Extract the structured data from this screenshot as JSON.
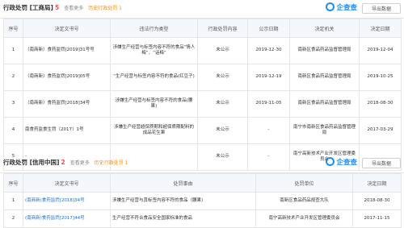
{
  "section1": {
    "title": "行政处罚 [工商局]",
    "count": "5",
    "more": "查看更多",
    "history": "历史行政处罚 1",
    "brand": "企查查",
    "export": "导出数据",
    "headers": [
      "序号",
      "决定文书号",
      "违法行为类型",
      "行政处罚内容",
      "公示日期",
      "决定机关",
      "决定日期"
    ],
    "rows": [
      [
        "1",
        "（南商新）食药监罚[2019]31号号",
        "涉嫌生产经营与标签内容不符的食品“情人梅”、“话梅”",
        "未公示",
        "2019-12-30",
        "南新区食品药品监督管理局",
        "2019-12-04"
      ],
      [
        "2",
        "（南商新）食药监罚[2019]05号",
        "“生产经营与标签内容不符的食品(红豆子)",
        "未公示",
        "2019-12-19",
        "南新区食品药品监督管理局",
        "2019-10-25"
      ],
      [
        "3",
        "（南商新）食药监罚[2018]34号",
        "涉嫌生产经营与标签内容不符的食品(腰果)",
        "未公示",
        "2019-11-05",
        "南新区食品药品监督管理局",
        "2018-08-30"
      ],
      [
        "4",
        "南食药监食生罚〔2017〕1号",
        "涉嫌生产经营超保质期和超保质期配料的成品花生果",
        "未公示",
        "-",
        "南宁市南新区食品药品监督管理局",
        "2017-03-29"
      ],
      [
        "5",
        "-",
        "",
        "未公示",
        "-",
        "南宁高新技术产业开发区管理委员会",
        ""
      ]
    ]
  },
  "section2": {
    "title": "行政处罚 [信用中国]",
    "count": "2",
    "more": "查看更多",
    "history": "历史行政处罚 1",
    "brand": "企查查",
    "export": "导出数据",
    "headers": [
      "序号",
      "决定文书号",
      "处罚事由",
      "处罚单位",
      "决定日期"
    ],
    "rows": [
      [
        "1",
        "(南商新)食药监罚[2018]34号",
        "涉嫌生产经营与其标签内容不符的食品（腰果)",
        "南新区食品药品规查大队",
        "2018-08-30"
      ],
      [
        "2",
        "(南商新)食药监罚[2017]44号",
        "生产经营不符合食品安全国家标准的食品",
        "南宁高新技术产业开发区管理委员会",
        "2017-11-15"
      ]
    ]
  }
}
